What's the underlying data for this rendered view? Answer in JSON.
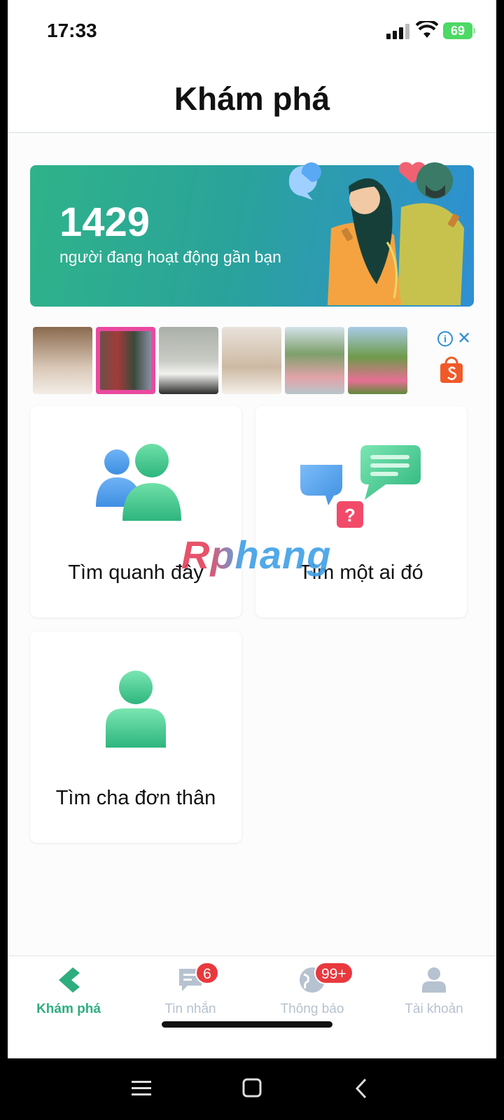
{
  "status_bar": {
    "time": "17:33",
    "battery": "69"
  },
  "header": {
    "title": "Khám phá"
  },
  "banner": {
    "count": "1429",
    "text": "người đang hoạt động gần bạn"
  },
  "watermark": "Rphang",
  "cards": [
    {
      "label": "Tìm quanh đây",
      "icon": "people-icon"
    },
    {
      "label": "Tìm một ai đó",
      "icon": "chat-question-icon"
    },
    {
      "label": "Tìm cha đơn thân",
      "icon": "person-icon"
    }
  ],
  "tabs": [
    {
      "label": "Khám phá",
      "icon": "explore-icon",
      "active": true
    },
    {
      "label": "Tin nhắn",
      "icon": "message-icon",
      "badge": "6"
    },
    {
      "label": "Thông báo",
      "icon": "globe-icon",
      "badge": "99+"
    },
    {
      "label": "Tài khoản",
      "icon": "account-icon"
    }
  ],
  "colors": {
    "accent": "#2eae7e",
    "badge": "#e8393e",
    "fab": "#0f2a2b"
  }
}
